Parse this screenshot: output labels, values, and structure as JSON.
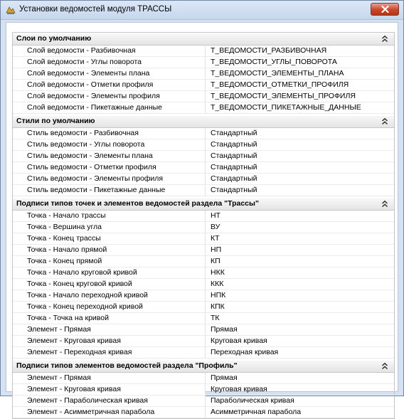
{
  "window": {
    "title": "Установки ведомостей модуля ТРАССЫ"
  },
  "sections": [
    {
      "title": "Слои по умолчанию",
      "rows": [
        {
          "name": "Слой ведомости - Разбивочная",
          "value": "Т_ВЕДОМОСТИ_РАЗБИВОЧНАЯ"
        },
        {
          "name": "Слой ведомости - Углы поворота",
          "value": "Т_ВЕДОМОСТИ_УГЛЫ_ПОВОРОТА"
        },
        {
          "name": "Слой ведомости - Элементы плана",
          "value": "Т_ВЕДОМОСТИ_ЭЛЕМЕНТЫ_ПЛАНА"
        },
        {
          "name": "Слой ведомости - Отметки профиля",
          "value": "Т_ВЕДОМОСТИ_ОТМЕТКИ_ПРОФИЛЯ"
        },
        {
          "name": "Слой ведомости - Элементы профиля",
          "value": "Т_ВЕДОМОСТИ_ЭЛЕМЕНТЫ_ПРОФИЛЯ"
        },
        {
          "name": "Слой ведомости - Пикетажные данные",
          "value": "Т_ВЕДОМОСТИ_ПИКЕТАЖНЫЕ_ДАННЫЕ"
        }
      ]
    },
    {
      "title": "Стили по умолчанию",
      "rows": [
        {
          "name": "Стиль ведомости - Разбивочная",
          "value": "Стандартный"
        },
        {
          "name": "Стиль ведомости - Углы поворота",
          "value": "Стандартный"
        },
        {
          "name": "Стиль ведомости - Элементы плана",
          "value": "Стандартный"
        },
        {
          "name": "Стиль ведомости - Отметки профиля",
          "value": "Стандартный"
        },
        {
          "name": "Стиль ведомости - Элементы профиля",
          "value": "Стандартный"
        },
        {
          "name": "Стиль ведомости - Пикетажные данные",
          "value": "Стандартный"
        }
      ]
    },
    {
      "title": "Подписи типов точек и элементов ведомостей раздела \"Трассы\"",
      "rows": [
        {
          "name": "Точка - Начало трассы",
          "value": "НТ"
        },
        {
          "name": "Точка - Вершина угла",
          "value": "ВУ"
        },
        {
          "name": "Точка - Конец трассы",
          "value": "КТ"
        },
        {
          "name": "Точка - Начало прямой",
          "value": "НП"
        },
        {
          "name": "Точка - Конец прямой",
          "value": "КП"
        },
        {
          "name": "Точка - Начало круговой кривой",
          "value": "НКК"
        },
        {
          "name": "Точка - Конец круговой кривой",
          "value": "ККК"
        },
        {
          "name": "Точка - Начало переходной кривой",
          "value": "НПК"
        },
        {
          "name": "Точка - Конец переходной кривой",
          "value": "КПК"
        },
        {
          "name": "Точка - Точка на кривой",
          "value": "ТК"
        },
        {
          "name": "Элемент - Прямая",
          "value": "Прямая"
        },
        {
          "name": "Элемент - Круговая кривая",
          "value": "Круговая кривая"
        },
        {
          "name": "Элемент - Переходная кривая",
          "value": "Переходная кривая"
        }
      ]
    },
    {
      "title": "Подписи типов элементов ведомостей раздела \"Профиль\"",
      "rows": [
        {
          "name": "Элемент - Прямая",
          "value": "Прямая"
        },
        {
          "name": "Элемент - Круговая кривая",
          "value": "Круговая кривая"
        },
        {
          "name": "Элемент - Параболическая кривая",
          "value": "Параболическая кривая"
        },
        {
          "name": "Элемент - Асимметричная парабола",
          "value": "Асимметричная парабола"
        }
      ]
    }
  ],
  "icons": {
    "app": "app-icon",
    "close": "close-icon",
    "collapse": "double-chevron-up-icon"
  },
  "colors": {
    "title_bg": "#c6d7ed",
    "close_button": "#c8452c",
    "section_header": "#e4e4e4"
  }
}
